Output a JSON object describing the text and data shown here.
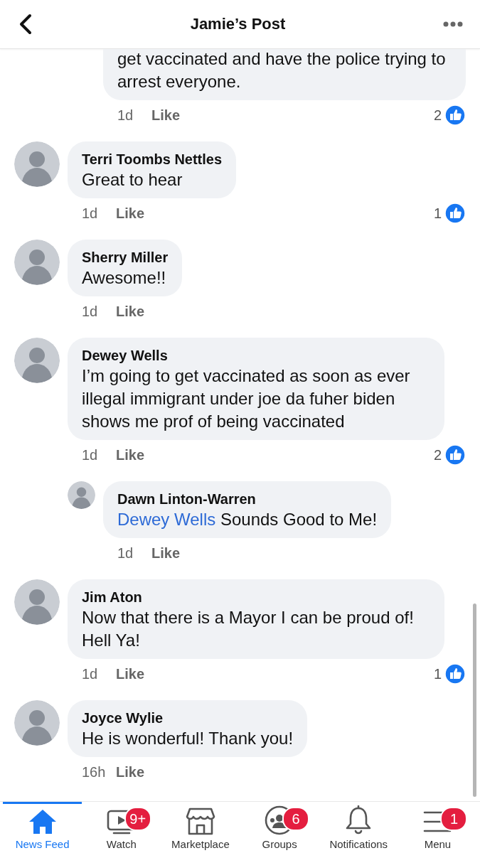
{
  "header": {
    "title": "Jamie’s Post"
  },
  "comments": [
    {
      "text": "get vaccinated and have the police trying to arrest everyone.",
      "time": "1d",
      "action": "Like",
      "likes": "2",
      "reply": true,
      "cut": true
    },
    {
      "name": "Terri Toombs Nettles",
      "text": "Great to hear",
      "time": "1d",
      "action": "Like",
      "likes": "1",
      "reply": false
    },
    {
      "name": "Sherry Miller",
      "text": "Awesome!!",
      "time": "1d",
      "action": "Like",
      "reply": false
    },
    {
      "name": "Dewey Wells",
      "text": "I’m going to get vaccinated as soon as ever illegal immigrant under joe da fuher biden shows me prof of being vaccinated",
      "time": "1d",
      "action": "Like",
      "likes": "2",
      "reply": false
    },
    {
      "name": "Dawn Linton-Warren",
      "mention": "Dewey Wells",
      "text": "Sounds Good to Me!",
      "time": "1d",
      "action": "Like",
      "reply": true
    },
    {
      "name": "Jim Aton",
      "text": "Now that there is a Mayor I can be proud of! Hell Ya!",
      "time": "1d",
      "action": "Like",
      "likes": "1",
      "reply": false
    },
    {
      "name": "Joyce Wylie",
      "text": "He is wonderful!  Thank you!",
      "time": "16h",
      "action": "Like",
      "reply": false
    }
  ],
  "nav": [
    {
      "kind": "home",
      "label": "News Feed",
      "selected": true
    },
    {
      "kind": "watch",
      "label": "Watch",
      "badge": "9+",
      "selected": false
    },
    {
      "kind": "marketplace",
      "label": "Marketplace",
      "selected": false
    },
    {
      "kind": "groups",
      "label": "Groups",
      "badge": "6",
      "selected": false
    },
    {
      "kind": "bell",
      "label": "Notifications",
      "selected": false
    },
    {
      "kind": "menu",
      "label": "Menu",
      "badge": "1",
      "selected": false
    }
  ]
}
